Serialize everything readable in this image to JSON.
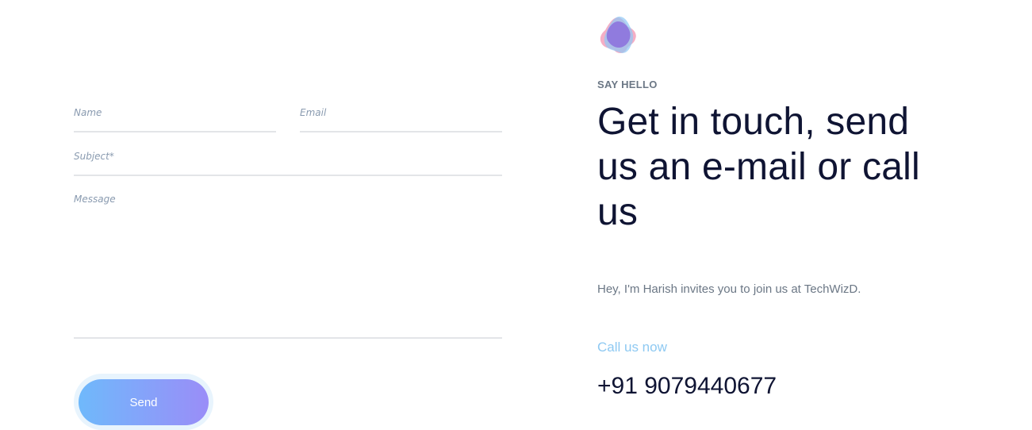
{
  "form": {
    "name_placeholder": "Name",
    "email_placeholder": "Email",
    "subject_placeholder": "Subject*",
    "message_placeholder": "Message",
    "name_value": "",
    "email_value": "",
    "subject_value": "",
    "message_value": "",
    "send_label": "Send"
  },
  "contact": {
    "logo_icon": "blob-star-logo-icon",
    "eyebrow": "SAY HELLO",
    "headline": "Get in touch, send us an e-mail or call us",
    "intro": "Hey, I'm Harish invites you to join us at TechWizD.",
    "call_label": "Call us now",
    "phone": "+91 9079440677"
  },
  "colors": {
    "headline": "#0f1433",
    "muted": "#6b7785",
    "accent_link": "#8ec9f2",
    "button_gradient_start": "#6fb9fb",
    "button_gradient_end": "#9a8df8"
  }
}
